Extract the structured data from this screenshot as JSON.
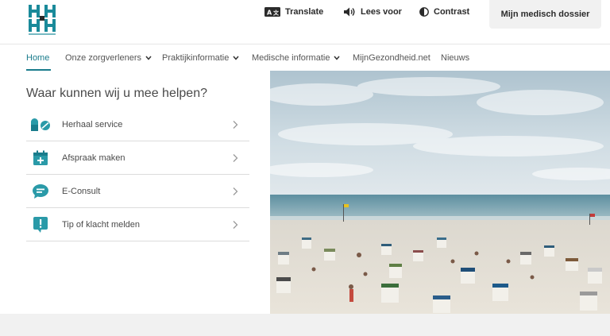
{
  "header": {
    "logo_name": "practice-logo",
    "utilities": {
      "translate": "Translate",
      "lees_voor": "Lees voor",
      "contrast": "Contrast"
    },
    "dossier_button": "Mijn medisch dossier"
  },
  "nav": {
    "items": [
      {
        "label": "Home",
        "active": true,
        "dropdown": false
      },
      {
        "label": "Onze zorgverleners",
        "active": false,
        "dropdown": true
      },
      {
        "label": "Praktijkinformatie",
        "active": false,
        "dropdown": true
      },
      {
        "label": "Medische informatie",
        "active": false,
        "dropdown": true
      },
      {
        "label": "MijnGezondheid.net",
        "active": false,
        "dropdown": false
      },
      {
        "label": "Nieuws",
        "active": false,
        "dropdown": false
      }
    ]
  },
  "help": {
    "title": "Waar kunnen wij u mee helpen?",
    "items": [
      {
        "label": "Herhaal service",
        "icon": "pills-icon"
      },
      {
        "label": "Afspraak maken",
        "icon": "calendar-plus-icon"
      },
      {
        "label": "E-Consult",
        "icon": "chat-bubble-icon"
      },
      {
        "label": "Tip of klacht melden",
        "icon": "exclamation-bubble-icon"
      }
    ]
  },
  "hero": {
    "image": "beach-photo"
  },
  "colors": {
    "accent": "#1a7c8c",
    "accent_light": "#2a9aa8",
    "border": "#dcdcdc",
    "footer_band": "#f1f1f1"
  }
}
